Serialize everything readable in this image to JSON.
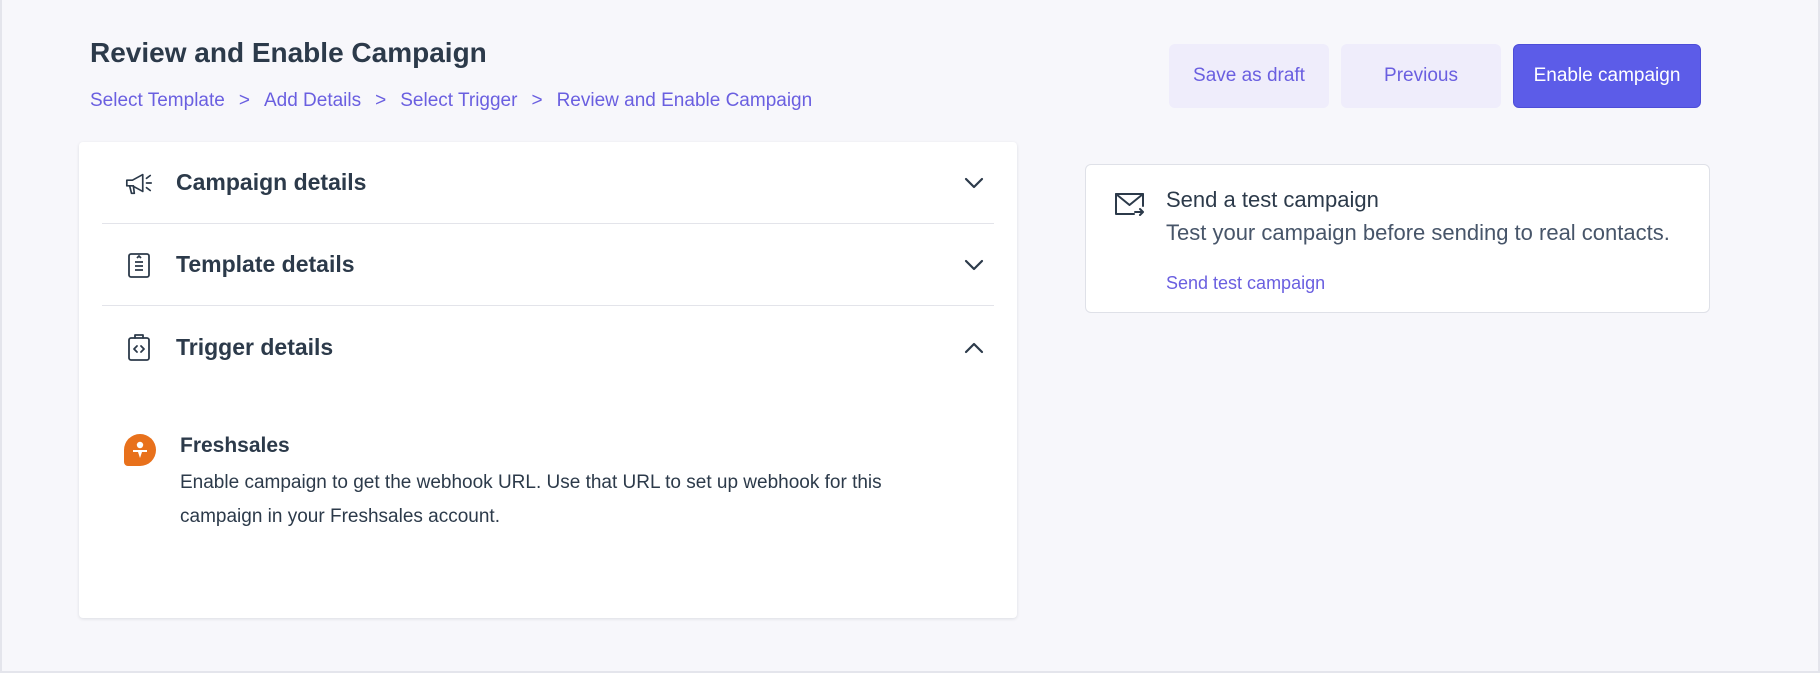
{
  "header": {
    "title": "Review and Enable Campaign",
    "breadcrumb": [
      {
        "label": "Select Template"
      },
      {
        "label": "Add Details"
      },
      {
        "label": "Select Trigger"
      },
      {
        "label": "Review and Enable Campaign"
      }
    ],
    "separator": ">"
  },
  "actions": {
    "save_draft": "Save as draft",
    "previous": "Previous",
    "enable": "Enable campaign"
  },
  "accordion": {
    "sections": [
      {
        "title": "Campaign details",
        "icon": "megaphone-icon",
        "expanded": false
      },
      {
        "title": "Template details",
        "icon": "document-icon",
        "expanded": false
      },
      {
        "title": "Trigger details",
        "icon": "code-clipboard-icon",
        "expanded": true
      }
    ],
    "trigger": {
      "app_icon": "freshsales-logo-icon",
      "name": "Freshsales",
      "description": "Enable campaign to get the webhook URL. Use that URL to set up webhook for this campaign in your Freshsales account."
    }
  },
  "test_card": {
    "icon": "mail-send-icon",
    "title": "Send a test campaign",
    "subtitle": "Test your campaign before sending to real contacts.",
    "link": "Send test campaign"
  },
  "colors": {
    "accent": "#5c5ce8",
    "link": "#6a5fe0",
    "light_button": "#efedfb",
    "freshsales_orange": "#e8711c",
    "background": "#f7f7fb"
  }
}
